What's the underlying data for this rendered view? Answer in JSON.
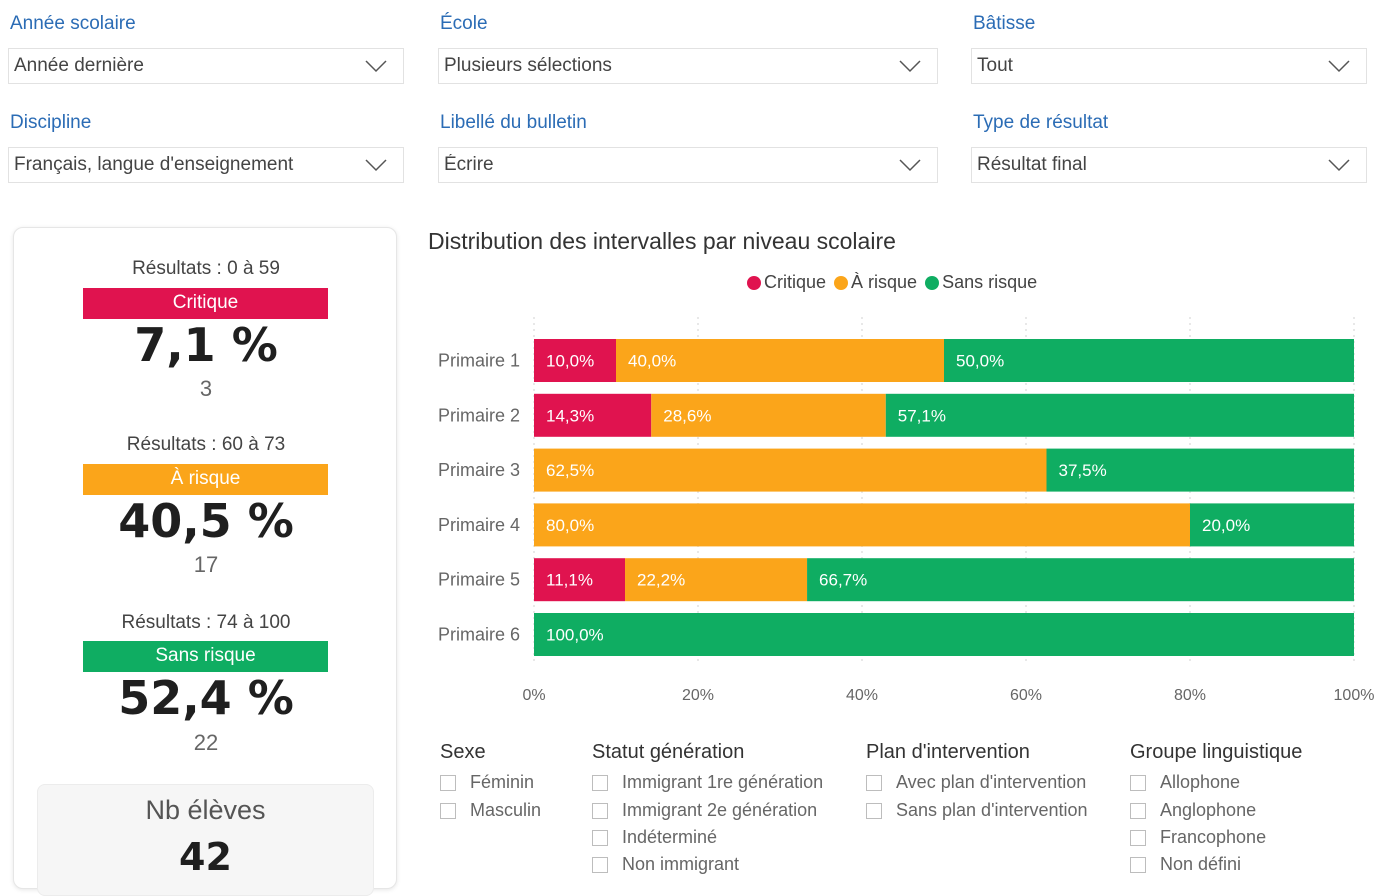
{
  "filters": {
    "annee": {
      "label": "Année scolaire",
      "value": "Année dernière"
    },
    "ecole": {
      "label": "École",
      "value": "Plusieurs sélections"
    },
    "batisse": {
      "label": "Bâtisse",
      "value": "Tout"
    },
    "discipline": {
      "label": "Discipline",
      "value": "Français, langue d'enseignement"
    },
    "libelle": {
      "label": "Libellé du bulletin",
      "value": "Écrire"
    },
    "type_resultat": {
      "label": "Type de résultat",
      "value": "Résultat final"
    }
  },
  "summary": {
    "critique": {
      "range": "Résultats : 0 à 59",
      "band": "Critique",
      "pct": "7,1 %",
      "count": "3"
    },
    "risque": {
      "range": "Résultats : 60 à 73",
      "band": "À risque",
      "pct": "40,5 %",
      "count": "17"
    },
    "sans_risque": {
      "range": "Résultats : 74 à 100",
      "band": "Sans risque",
      "pct": "52,4 %",
      "count": "22"
    },
    "nb_eleves": {
      "label": "Nb élèves",
      "value": "42"
    }
  },
  "colors": {
    "critique": "#e0134f",
    "risque": "#fba51a",
    "sans_risque": "#0fad62"
  },
  "chart_data": {
    "type": "bar",
    "orientation": "horizontal-stacked",
    "title": "Distribution des intervalles par niveau scolaire",
    "categories": [
      "Primaire 1",
      "Primaire 2",
      "Primaire 3",
      "Primaire 4",
      "Primaire 5",
      "Primaire 6"
    ],
    "series": [
      {
        "name": "Critique",
        "color": "#e0134f",
        "values": [
          10.0,
          14.3,
          0,
          0,
          11.1,
          0
        ],
        "labels": [
          "10,0%",
          "14,3%",
          "",
          "",
          "11,1%",
          ""
        ]
      },
      {
        "name": "À risque",
        "color": "#fba51a",
        "values": [
          40.0,
          28.6,
          62.5,
          80.0,
          22.2,
          0
        ],
        "labels": [
          "40,0%",
          "28,6%",
          "62,5%",
          "80,0%",
          "22,2%",
          ""
        ]
      },
      {
        "name": "Sans risque",
        "color": "#0fad62",
        "values": [
          50.0,
          57.1,
          37.5,
          20.0,
          66.7,
          100.0
        ],
        "labels": [
          "50,0%",
          "57,1%",
          "37,5%",
          "20,0%",
          "66,7%",
          "100,0%"
        ]
      }
    ],
    "xlim": [
      0,
      100
    ],
    "xticks": [
      "0%",
      "20%",
      "40%",
      "60%",
      "80%",
      "100%"
    ],
    "legend_position": "top-center",
    "grid": "vertical-dotted"
  },
  "slicers": {
    "sexe": {
      "title": "Sexe",
      "options": [
        "Féminin",
        "Masculin"
      ]
    },
    "statut": {
      "title": "Statut génération",
      "options": [
        "Immigrant 1re génération",
        "Immigrant 2e génération",
        "Indéterminé",
        "Non immigrant"
      ]
    },
    "plan": {
      "title": "Plan d'intervention",
      "options": [
        "Avec plan d'intervention",
        "Sans plan d'intervention"
      ]
    },
    "groupe": {
      "title": "Groupe linguistique",
      "options": [
        "Allophone",
        "Anglophone",
        "Francophone",
        "Non défini"
      ]
    }
  }
}
